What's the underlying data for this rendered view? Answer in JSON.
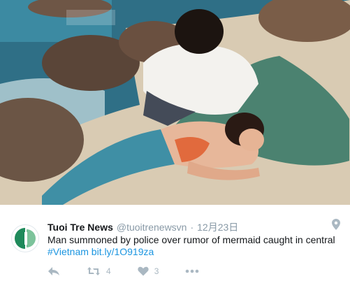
{
  "tweet": {
    "display_name": "Tuoi Tre News",
    "handle": "@tuoitrenewsvn",
    "separator": "·",
    "date": "12月23日",
    "text": "Man summoned by police over rumor of mermaid caught in central",
    "hashtag": "#Vietnam",
    "link": "bit.ly/1O919za"
  },
  "actions": {
    "retweet_count": "4",
    "like_count": "3"
  },
  "colors": {
    "link": "#1b95e0",
    "muted": "#8899a6",
    "icon": "#aab8c2",
    "text": "#14171a"
  },
  "icons": [
    "reply-icon",
    "retweet-icon",
    "heart-icon",
    "more-icon",
    "location-pin-icon"
  ]
}
